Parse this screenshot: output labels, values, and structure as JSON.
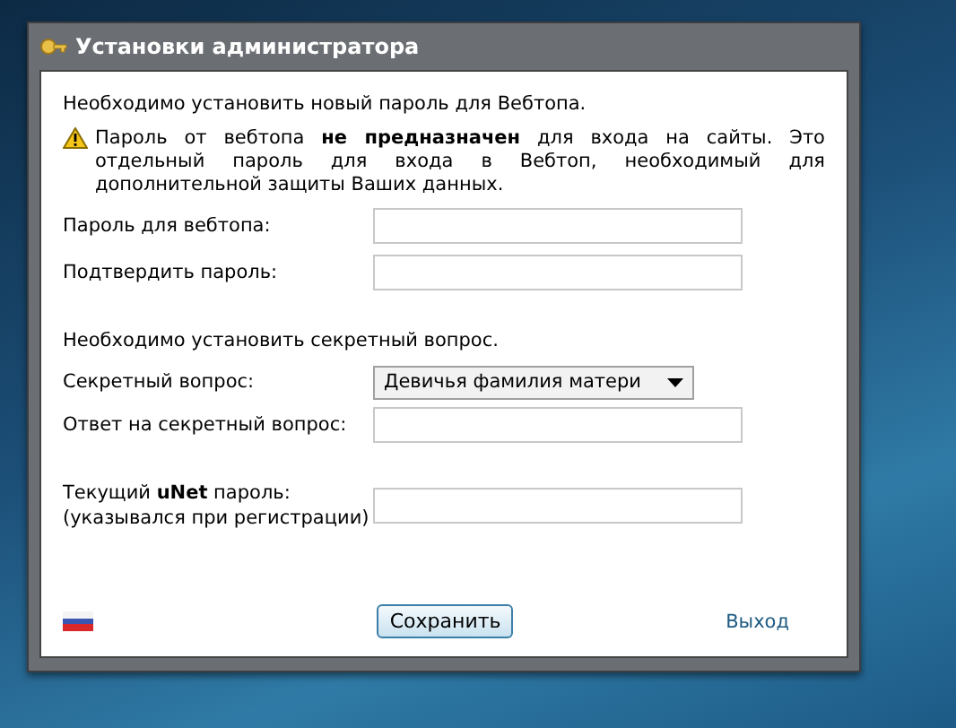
{
  "window": {
    "title": "Установки администратора"
  },
  "intro": "Необходимо установить новый пароль для Вебтопа.",
  "warning": "Пароль от вебтопа **не предназначен** для входа на сайты. Это отдельный пароль для входа в Вебтоп, необходимый для дополнительной защиты Ваших данных.",
  "password_fields": [
    {
      "label": "Пароль для вебтопа:"
    },
    {
      "label": "Подтвердить пароль:"
    }
  ],
  "secret_intro": "Необходимо установить секретный вопрос.",
  "secret_question": {
    "label": "Секретный вопрос:",
    "value": "Девичья фамилия матери"
  },
  "secret_answer": {
    "label": "Ответ на секретный вопрос:"
  },
  "current_password": {
    "label": "Текущий **uNet** пароль:",
    "hint": "(указывался при регистрации)"
  },
  "footer": {
    "save_button": "Сохранить",
    "exit_link": "Выход"
  }
}
